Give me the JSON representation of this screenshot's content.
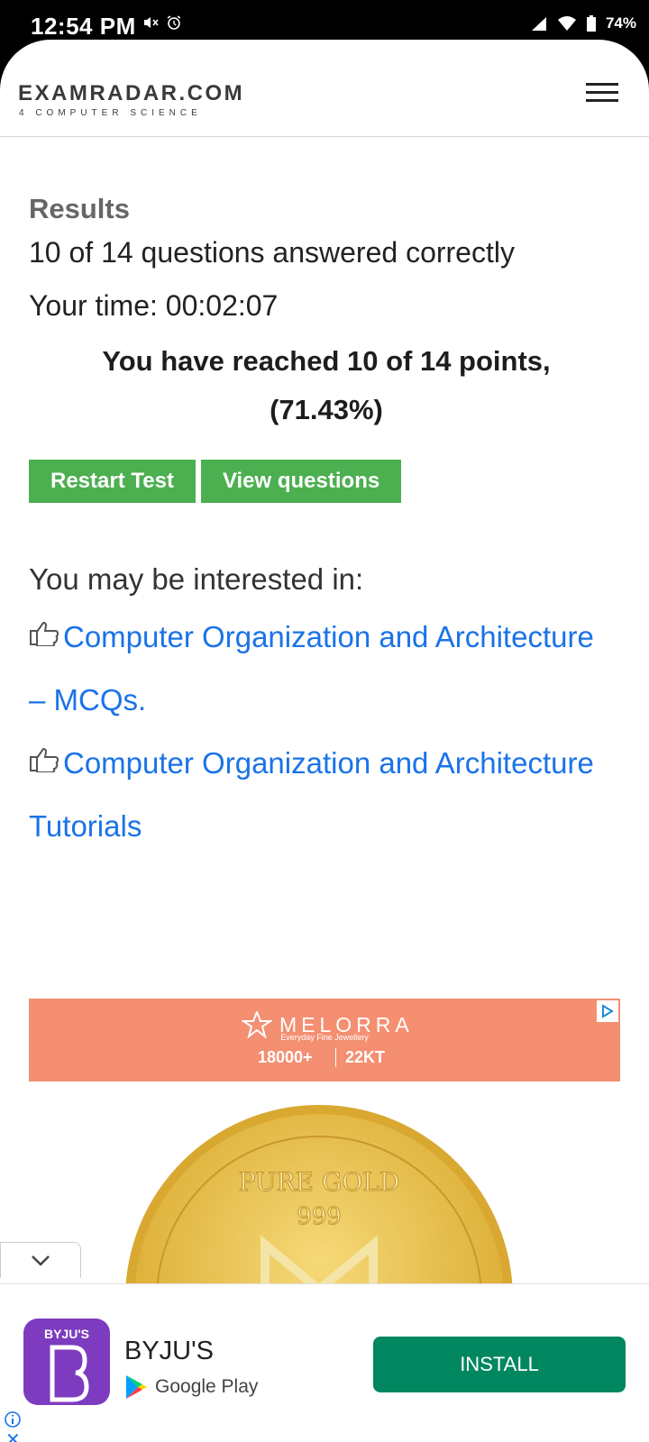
{
  "status_bar": {
    "time": "12:54 PM",
    "battery": "74%",
    "icons": [
      "mute-icon",
      "alarm-icon",
      "signal-icon",
      "wifi-icon",
      "battery-icon"
    ]
  },
  "header": {
    "logo_title": "EXAMRADAR.COM",
    "logo_subtitle": "4 COMPUTER SCIENCE",
    "menu_icon": "hamburger-menu-icon"
  },
  "results": {
    "heading": "Results",
    "score_text": "10 of 14 questions answered correctly",
    "time_text": "Your time: 00:02:07",
    "points_line1": "You have reached 10 of 14 points,",
    "points_line2": "(71.43%)"
  },
  "buttons": {
    "restart": "Restart Test",
    "view_questions": "View questions"
  },
  "interested": {
    "label": "You may be interested in:",
    "links": [
      {
        "line1": "Computer Organization and Architecture",
        "line2": "– MCQs."
      },
      {
        "line1": "Computer Organization and Architecture",
        "line2": "Tutorials"
      }
    ]
  },
  "ad_banner": {
    "brand": "MELORRA",
    "tagline": "Everyday Fine Jewellery",
    "stat1": "18000+",
    "stat2": "22KT",
    "coin_text_top": "PURE GOLD",
    "coin_text_mid": "999",
    "colors": {
      "banner": "#f48f72",
      "coin": "#e8c04a"
    }
  },
  "bottom_ad": {
    "app_icon_label": "BYJU'S",
    "app_name": "BYJU'S",
    "store": "Google Play",
    "install": "INSTALL",
    "colors": {
      "install": "#01875f",
      "icon": "#7d3cbf"
    }
  }
}
